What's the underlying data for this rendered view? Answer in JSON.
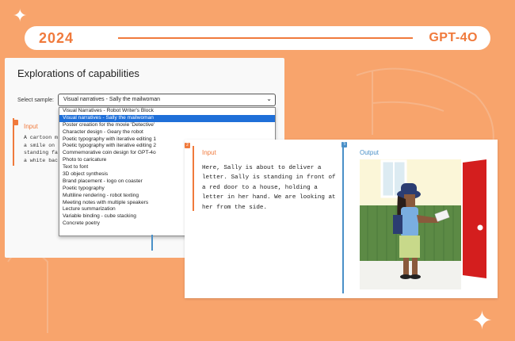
{
  "banner": {
    "year": "2024",
    "model": "GPT-4O"
  },
  "left_panel": {
    "title": "Explorations of capabilities",
    "select_label": "Select sample:",
    "select_value": "Visual narratives - Sally the mailwoman",
    "input_label": "Input",
    "input_text": "A cartoon m\na smile on\nstanding fa\na white bac",
    "options": [
      "Visual Narratives - Robot Writer's Block",
      "Visual narratives - Sally the mailwoman",
      "Poster creation for the movie 'Detective'",
      "Character design - Geary the robot",
      "Poetic typography with iterative editing 1",
      "Poetic typography with iterative editing 2",
      "Commemorative coin design for GPT-4o",
      "Photo to caricature",
      "Text to font",
      "3D object synthesis",
      "Brand placement - logo on coaster",
      "Poetic typography",
      "Multiline rendering - robot texting",
      "Meeting notes with multiple speakers",
      "Lecture summarization",
      "Variable binding - cube stacking",
      "Concrete poetry"
    ],
    "selected_index": 1
  },
  "card": {
    "input_label": "Input",
    "input_text": "Here, Sally is about to deliver a letter. Sally is standing in front of a red door to a house, holding a letter in her hand. We are looking at her from the side.",
    "output_label": "Output",
    "num_input": "2",
    "num_output": "3"
  },
  "colors": {
    "background": "#f8a46c",
    "accent": "#f07a3c",
    "blue": "#4a90c8",
    "selected": "#1f6fd8"
  }
}
